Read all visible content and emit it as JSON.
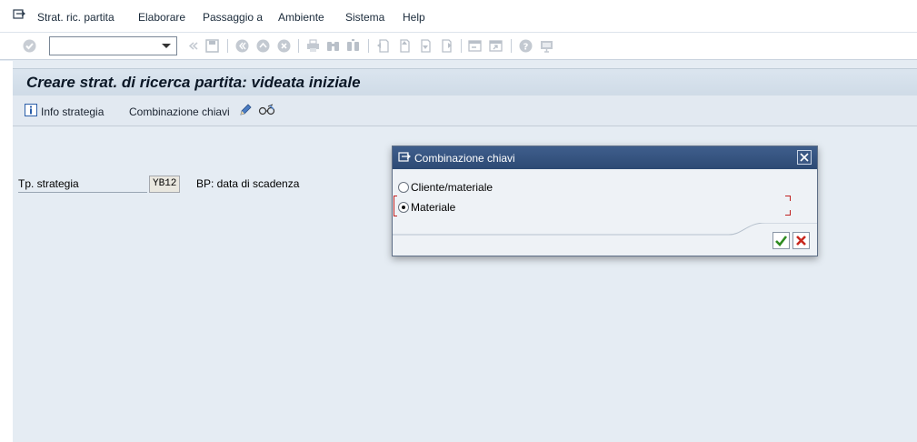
{
  "menu": {
    "items": [
      "Strat. ric. partita",
      "Elaborare",
      "Passaggio a",
      "Ambiente",
      "Sistema",
      "Help"
    ]
  },
  "toolbar": {
    "command_field_value": "",
    "icons": [
      "enter-icon",
      "back-icon",
      "save-icon",
      "back-nav-icon",
      "exit-icon",
      "cancel-icon",
      "print-icon",
      "find-icon",
      "find-next-icon",
      "first-page-icon",
      "prev-page-icon",
      "next-page-icon",
      "last-page-icon",
      "new-session-icon",
      "shortcut-icon",
      "help-icon",
      "layout-icon"
    ]
  },
  "screen": {
    "title": "Creare strat. di ricerca partita: videata iniziale",
    "buttons": {
      "info": "Info strategia",
      "key_combination": "Combinazione chiavi"
    }
  },
  "form": {
    "strategy_label": "Tp. strategia",
    "strategy_value": "YB12",
    "strategy_desc": "BP: data di scadenza"
  },
  "dialog": {
    "title": "Combinazione chiavi",
    "options": [
      {
        "label": "Cliente/materiale",
        "selected": false
      },
      {
        "label": "Materiale",
        "selected": true
      }
    ]
  },
  "colors": {
    "dialog_title_bg": "#2d4a74",
    "ok_green": "#2e8b20",
    "cancel_red": "#c8281e"
  }
}
